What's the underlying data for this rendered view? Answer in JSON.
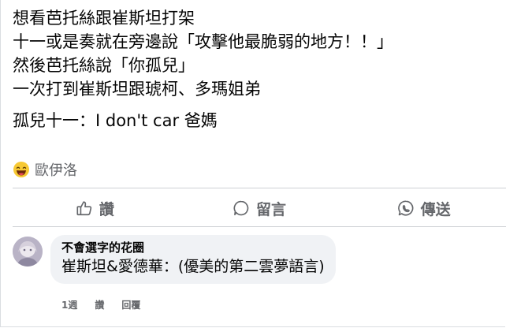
{
  "post": {
    "lines": [
      "想看芭托絲跟崔斯坦打架",
      "十一或是奏就在旁邊說「攻擊他最脆弱的地方！！」",
      "然後芭托絲說「你孤兒」",
      "一次打到崔斯坦跟琥柯、多瑪姐弟",
      "孤兒十一：I don't car 爸媽"
    ]
  },
  "reactions": {
    "emoji": "laughing-face",
    "names": "歐伊洛"
  },
  "actions": {
    "like": "讚",
    "comment": "留言",
    "share": "傳送"
  },
  "comment": {
    "author": "不會選字的花圈",
    "text": "崔斯坦&愛德華：(優美的第二雲夢語言)",
    "time": "1週",
    "like": "讚",
    "reply": "回覆"
  },
  "colors": {
    "text": "#050505",
    "muted": "#65676b",
    "bubble": "#f0f2f5",
    "divider": "#ced0d4"
  }
}
